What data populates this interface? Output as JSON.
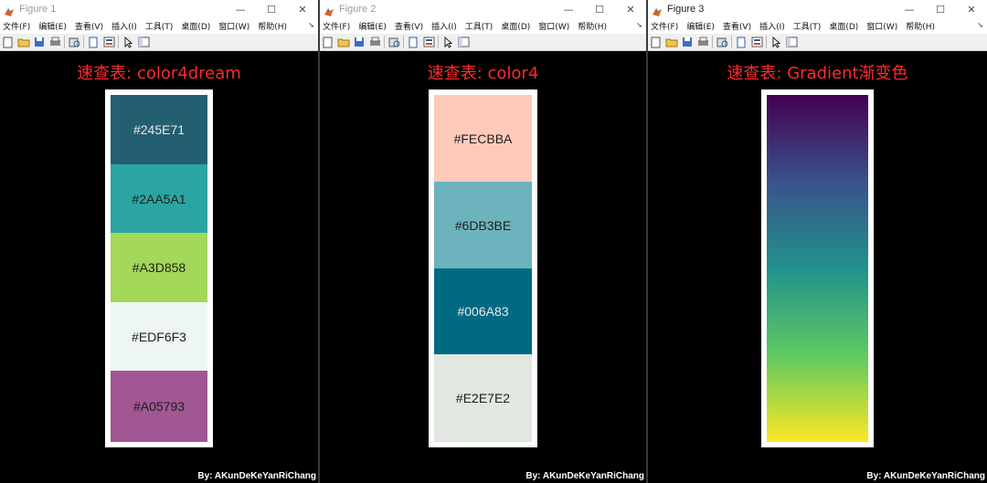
{
  "windows": [
    {
      "title": "Figure 1",
      "menus": [
        "文件(F)",
        "编辑(E)",
        "查看(V)",
        "插入(I)",
        "工具(T)",
        "桌面(D)",
        "窗口(W)",
        "帮助(H)"
      ],
      "plot_title": "速查表: color4dream",
      "swatches": [
        {
          "label": "#245E71",
          "color": "#245E71",
          "text_color": "#e8e8e8"
        },
        {
          "label": "#2AA5A1",
          "color": "#2AA5A1",
          "text_color": "#1e1e1e"
        },
        {
          "label": "#A3D858",
          "color": "#A3D858",
          "text_color": "#1e1e1e"
        },
        {
          "label": "#EDF6F3",
          "color": "#EDF6F3",
          "text_color": "#1e1e1e"
        },
        {
          "label": "#A05793",
          "color": "#A05793",
          "text_color": "#1e1e1e"
        }
      ],
      "credit": "By: AKunDeKeYanRiChang"
    },
    {
      "title": "Figure 2",
      "menus": [
        "文件(F)",
        "编辑(E)",
        "查看(V)",
        "插入(I)",
        "工具(T)",
        "桌面(D)",
        "窗口(W)",
        "帮助(H)"
      ],
      "plot_title": "速查表: color4",
      "swatches": [
        {
          "label": "#FECBBA",
          "color": "#FECBBA",
          "text_color": "#1e1e1e"
        },
        {
          "label": "#6DB3BE",
          "color": "#6DB3BE",
          "text_color": "#1e1e1e"
        },
        {
          "label": "#006A83",
          "color": "#006A83",
          "text_color": "#e8e8e8"
        },
        {
          "label": "#E2E7E2",
          "color": "#E2E7E2",
          "text_color": "#1e1e1e"
        }
      ],
      "credit": "By: AKunDeKeYanRiChang"
    },
    {
      "title": "Figure 3",
      "menus": [
        "文件(F)",
        "编辑(E)",
        "查看(V)",
        "插入(I)",
        "工具(T)",
        "桌面(D)",
        "窗口(W)",
        "帮助(H)"
      ],
      "plot_title": "速查表: Gradient渐变色",
      "gradient_stops": [
        "#440154",
        "#3b528b",
        "#21918c",
        "#5ec962",
        "#fde725"
      ],
      "credit": "By: AKunDeKeYanRiChang"
    }
  ],
  "window_buttons": {
    "minimize": "—",
    "maximize": "☐",
    "close": "✕"
  },
  "toolbar_icons": [
    "new-file-icon",
    "open-folder-icon",
    "save-icon",
    "print-icon",
    "print-preview-icon",
    "link-plot-icon",
    "insert-legend-icon",
    "pointer-icon",
    "property-editor-icon"
  ]
}
